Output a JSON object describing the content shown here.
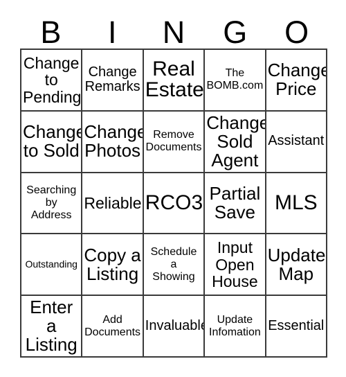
{
  "card": {
    "header_letters": [
      "B",
      "I",
      "N",
      "G",
      "O"
    ],
    "colors": {
      "background": "#ffffff",
      "grid_line": "#3a3a3a",
      "text": "#000000"
    },
    "rows": [
      [
        {
          "label": "Change\nto\nPending",
          "size": "lg"
        },
        {
          "label": "Change\nRemarks",
          "size": "md"
        },
        {
          "label": "Real\nEstate",
          "size": "xxl"
        },
        {
          "label": "The\nBOMB.com",
          "size": "sm"
        },
        {
          "label": "Change\nPrice",
          "size": "xl"
        }
      ],
      [
        {
          "label": "Change\nto Sold",
          "size": "xl"
        },
        {
          "label": "Change\nPhotos",
          "size": "xl"
        },
        {
          "label": "Remove\nDocuments",
          "size": "sm"
        },
        {
          "label": "Change\nSold\nAgent",
          "size": "xl"
        },
        {
          "label": "Assistant",
          "size": "md"
        }
      ],
      [
        {
          "label": "Searching\nby\nAddress",
          "size": "sm"
        },
        {
          "label": "Reliable",
          "size": "lg"
        },
        {
          "label": "RCO3",
          "size": "xxl"
        },
        {
          "label": "Partial\nSave",
          "size": "xl"
        },
        {
          "label": "MLS",
          "size": "xxl"
        }
      ],
      [
        {
          "label": "Outstanding",
          "size": "xs"
        },
        {
          "label": "Copy a\nListing",
          "size": "xl"
        },
        {
          "label": "Schedule\na\nShowing",
          "size": "sm"
        },
        {
          "label": "Input\nOpen\nHouse",
          "size": "lg"
        },
        {
          "label": "Update\nMap",
          "size": "xl"
        }
      ],
      [
        {
          "label": "Enter a\nListing",
          "size": "xl"
        },
        {
          "label": "Add\nDocuments",
          "size": "sm"
        },
        {
          "label": "Invaluable",
          "size": "md"
        },
        {
          "label": "Update\nInfomation",
          "size": "sm"
        },
        {
          "label": "Essential",
          "size": "md"
        }
      ]
    ]
  }
}
